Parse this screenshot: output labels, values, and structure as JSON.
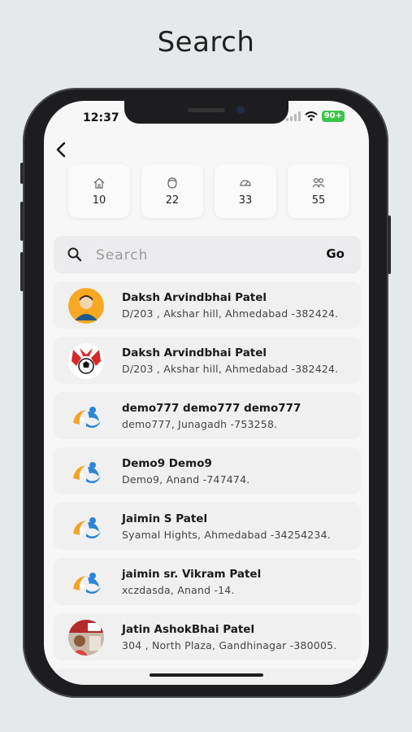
{
  "headline": "Search",
  "status": {
    "time": "12:37",
    "battery": "90+"
  },
  "stats": [
    {
      "icon": "home-icon",
      "value": "10"
    },
    {
      "icon": "face-icon",
      "value": "22"
    },
    {
      "icon": "meter-icon",
      "value": "33"
    },
    {
      "icon": "group-icon",
      "value": "55"
    }
  ],
  "search": {
    "placeholder": "Search",
    "go_label": "Go"
  },
  "results": [
    {
      "name": "Daksh Arvindbhai Patel",
      "address": "D/203 , Akshar hill, Ahmedabad -382424.",
      "avatar": "person-avatar"
    },
    {
      "name": "Daksh Arvindbhai Patel",
      "address": "D/203 , Akshar hill, Ahmedabad -382424.",
      "avatar": "sports-logo-avatar"
    },
    {
      "name": "demo777 demo777 demo777",
      "address": "demo777, Junagadh -753258.",
      "avatar": "brand-logo-avatar"
    },
    {
      "name": "Demo9  Demo9",
      "address": "Demo9, Anand -747474.",
      "avatar": "brand-logo-avatar"
    },
    {
      "name": "Jaimin S Patel",
      "address": "Syamal Hights, Ahmedabad -34254234.",
      "avatar": "brand-logo-avatar"
    },
    {
      "name": "jaimin sr. Vikram  Patel",
      "address": "xczdasda, Anand -14.",
      "avatar": "brand-logo-avatar"
    },
    {
      "name": "Jatin  AshokBhai Patel",
      "address": "304 , North Plaza, Gandhinagar -380005.",
      "avatar": "photo-avatar"
    }
  ]
}
